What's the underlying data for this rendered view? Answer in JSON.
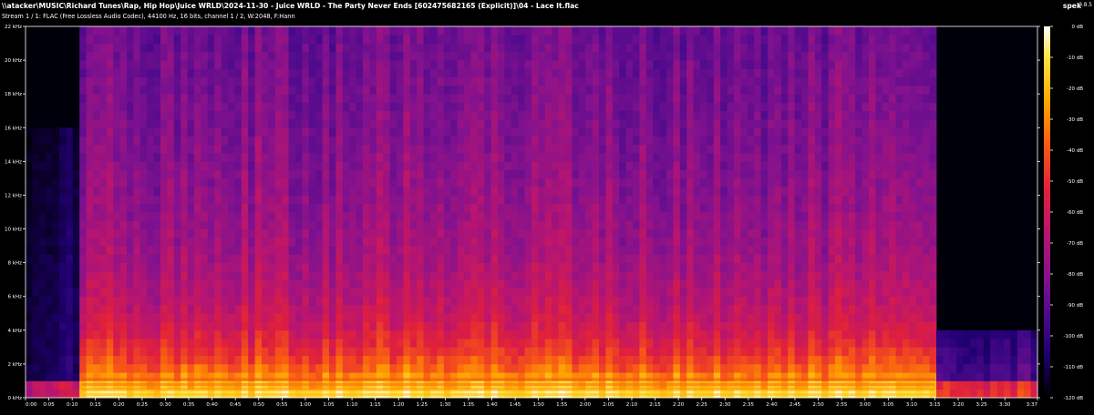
{
  "window": {
    "title": "\\\\atacker\\MUSIC\\Richard Tunes\\Rap, Hip Hop\\Juice WRLD\\2024-11-30 - Juice WRLD - The Party Never Ends [602475682165 (Explicit)]\\04 - Lace It.flac",
    "stream_info": "Stream 1 / 1: FLAC (Free Lossless Audio Codec), 44100 Hz, 16 bits, channel 1 / 2, W:2048, F:Hann",
    "app_name": "spek",
    "app_version": "0.8.5"
  },
  "colors": {
    "background": "#000000",
    "text": "#ffffff",
    "palette": [
      "#000000",
      "#0c0030",
      "#200070",
      "#4b0a8c",
      "#82128e",
      "#b81570",
      "#e0203c",
      "#f85a14",
      "#ffa800",
      "#ffe640",
      "#ffffff"
    ]
  },
  "chart_data": {
    "type": "heatmap",
    "x_axis": {
      "unit": "time",
      "range": [
        "0:00",
        "3:37"
      ],
      "tick_labels": [
        "0:00",
        "0:05",
        "0:10",
        "0:15",
        "0:20",
        "0:25",
        "0:30",
        "0:35",
        "0:40",
        "0:45",
        "0:50",
        "0:55",
        "1:00",
        "1:05",
        "1:10",
        "1:15",
        "1:20",
        "1:25",
        "1:30",
        "1:35",
        "1:40",
        "1:45",
        "1:50",
        "1:55",
        "2:00",
        "2:05",
        "2:10",
        "2:15",
        "2:20",
        "2:25",
        "2:30",
        "2:35",
        "2:40",
        "2:45",
        "2:50",
        "2:55",
        "3:00",
        "3:05",
        "3:10",
        "3:15",
        "3:20",
        "3:25",
        "3:30",
        "3:37"
      ]
    },
    "y_axis": {
      "unit": "kHz",
      "range": [
        0,
        22
      ],
      "tick_labels": [
        "0 kHz",
        "2 kHz",
        "4 kHz",
        "6 kHz",
        "8 kHz",
        "10 kHz",
        "12 kHz",
        "14 kHz",
        "16 kHz",
        "18 kHz",
        "20 kHz",
        "22 kHz"
      ]
    },
    "color_scale": {
      "unit": "dB",
      "range": [
        -120,
        0
      ],
      "tick_labels": [
        "0 dB",
        "-10 dB",
        "-20 dB",
        "-30 dB",
        "-40 dB",
        "-50 dB",
        "-60 dB",
        "-70 dB",
        "-80 dB",
        "-90 dB",
        "-100 dB",
        "-110 dB",
        "-120 dB"
      ]
    }
  }
}
